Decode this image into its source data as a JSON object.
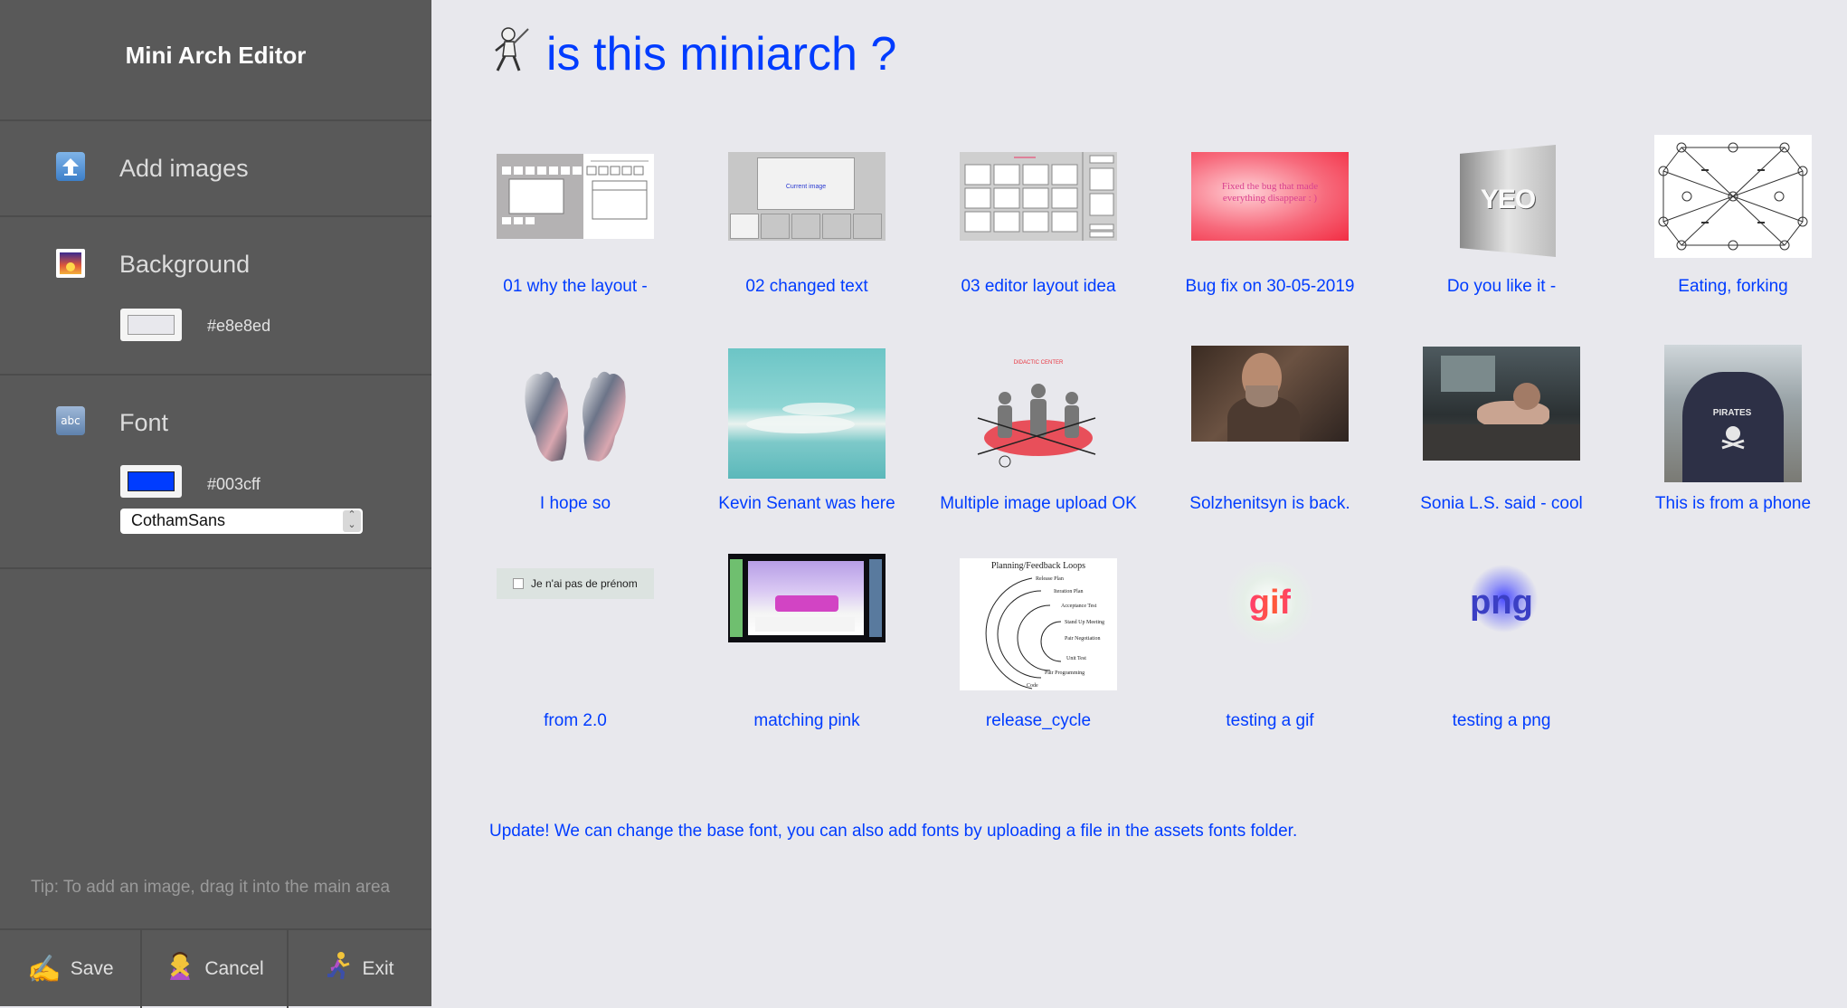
{
  "sidebar": {
    "title": "Mini Arch Editor",
    "add_images_label": "Add images",
    "background": {
      "label": "Background",
      "value": "#e8e8ed"
    },
    "font": {
      "label": "Font",
      "color": "#003cff",
      "family_selected": "CothamSans"
    },
    "tip": "Tip: To add an image, drag it into the main area",
    "buttons": {
      "save": "Save",
      "cancel": "Cancel",
      "exit": "Exit"
    }
  },
  "main": {
    "title": "is this miniarch ?",
    "items": [
      {
        "caption": "01 why the layout -",
        "thumb": "layout-wireframe"
      },
      {
        "caption": "02 changed text",
        "thumb": "current-image-wireframe",
        "thumb_text": "Current image"
      },
      {
        "caption": "03 editor layout idea",
        "thumb": "editor-grid-wireframe"
      },
      {
        "caption": "Bug fix on 30-05-2019",
        "thumb": "red-gradient",
        "thumb_text": "Fixed the bug that made everything disappear : )"
      },
      {
        "caption": "Do you like it -",
        "thumb": "yeo-3d-text",
        "thumb_text": "YEO"
      },
      {
        "caption": "Eating, forking",
        "thumb": "petri-net-diagram"
      },
      {
        "caption": "I hope so",
        "thumb": "chrome-hands"
      },
      {
        "caption": "Kevin Senant was here",
        "thumb": "teal-clouds"
      },
      {
        "caption": "Multiple image upload OK",
        "thumb": "figures-diagram"
      },
      {
        "caption": "Solzhenitsyn is back.",
        "thumb": "photo-portrait"
      },
      {
        "caption": "Sonia L.S. said - cool",
        "thumb": "photo-desk"
      },
      {
        "caption": "This is from a phone",
        "thumb": "photo-shirt"
      },
      {
        "caption": "from 2.0",
        "thumb": "checkbox-label",
        "thumb_text": "Je n'ai pas de prénom"
      },
      {
        "caption": "matching pink",
        "thumb": "retro-screenshot"
      },
      {
        "caption": "release_cycle",
        "thumb": "planning-loops",
        "thumb_text": "Planning/Feedback Loops"
      },
      {
        "caption": "testing a gif",
        "thumb": "gif-text",
        "thumb_text": "gif"
      },
      {
        "caption": "testing a png",
        "thumb": "png-text",
        "thumb_text": "png"
      }
    ],
    "update_note": "Update! We can change the base font, you can also add fonts by uploading a file in the assets fonts folder."
  }
}
